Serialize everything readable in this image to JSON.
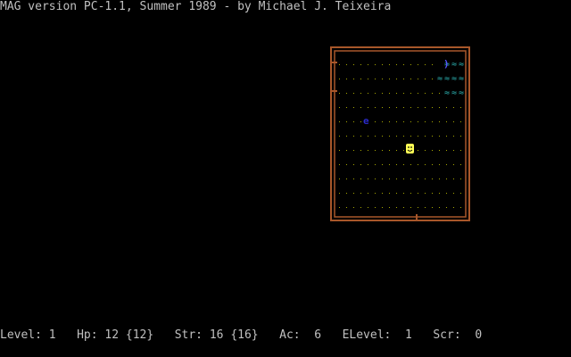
{
  "title": "MAG version PC-1.1, Summer 1989 - by Michael J. Teixeira",
  "status": {
    "level_label": "Level:",
    "level": "1",
    "hp_label": "Hp:",
    "hp": "12",
    "hp_max": "{12}",
    "str_label": "Str:",
    "str": "16",
    "str_max": "{16}",
    "ac_label": "Ac:",
    "ac": "6",
    "elevel_label": "ELevel:",
    "elevel": "1",
    "score_label": "Scr:",
    "score": "0"
  },
  "map": {
    "player_icon": "smiley-face-icon",
    "monster_icon": "monster-icon",
    "item_icon": "weapon-bracket-icon",
    "water_glyph": "≈",
    "item_glyph": ")",
    "monster_glyph": "e",
    "colors": {
      "wall": "#a8572a",
      "floor_dot": "#a8a800",
      "water": "#2aa8a8",
      "player_bg": "#ffff55",
      "monster": "#2a2ac8",
      "item": "#5555ff"
    }
  }
}
